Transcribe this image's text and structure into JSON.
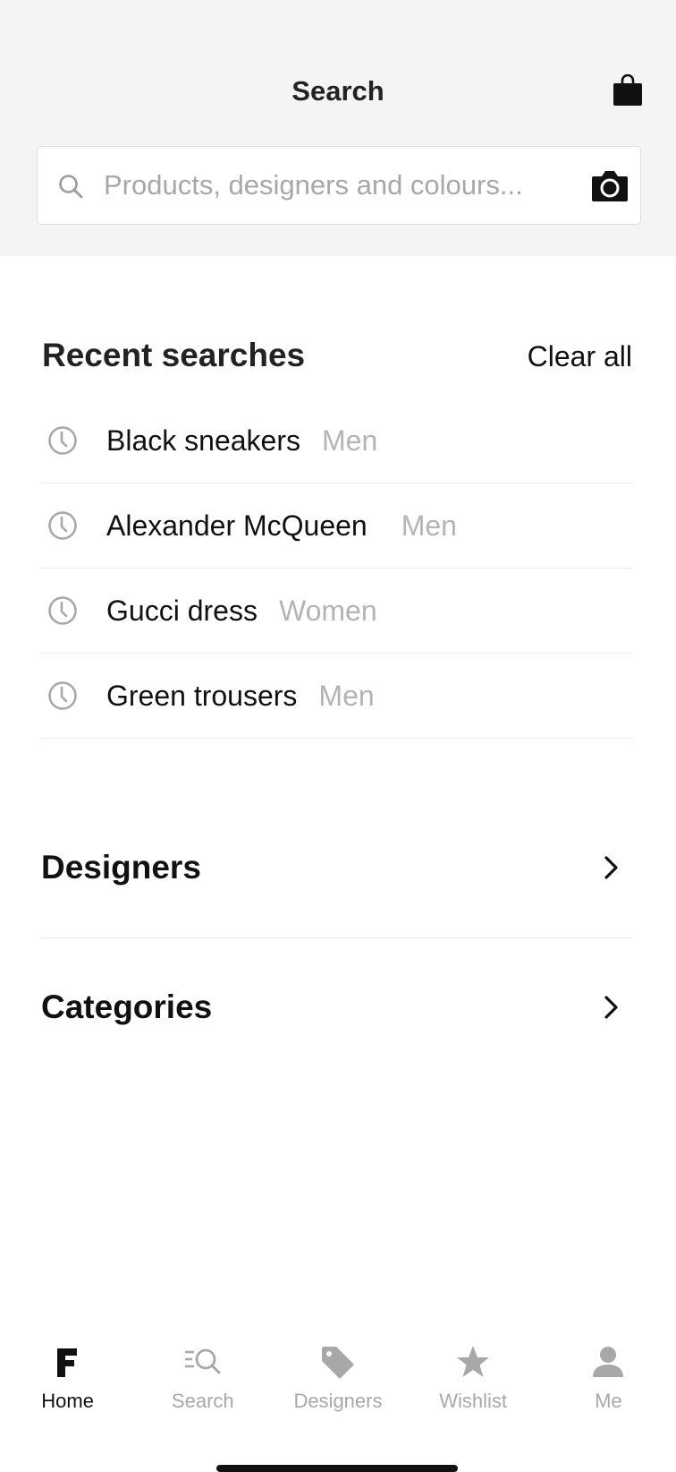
{
  "header": {
    "title": "Search",
    "bag_icon": "shopping-bag-icon"
  },
  "search": {
    "placeholder": "Products, designers and colours...",
    "value": "",
    "search_icon": "search-icon",
    "camera_icon": "camera-icon"
  },
  "recent": {
    "title": "Recent searches",
    "clear_label": "Clear all",
    "items": [
      {
        "query": "Black sneakers",
        "department": "Men"
      },
      {
        "query": "Alexander McQueen",
        "department": "Men"
      },
      {
        "query": "Gucci dress",
        "department": "Women"
      },
      {
        "query": "Green trousers",
        "department": "Men"
      }
    ]
  },
  "sections": {
    "designers": "Designers",
    "categories": "Categories"
  },
  "tabbar": {
    "items": [
      {
        "label": "Home",
        "icon": "home-f-icon",
        "active": true
      },
      {
        "label": "Search",
        "icon": "search-list-icon",
        "active": false
      },
      {
        "label": "Designers",
        "icon": "tag-icon",
        "active": false
      },
      {
        "label": "Wishlist",
        "icon": "star-icon",
        "active": false
      },
      {
        "label": "Me",
        "icon": "person-icon",
        "active": false
      }
    ]
  },
  "colors": {
    "header_bg": "#f4f4f4",
    "text_primary": "#111111",
    "text_muted": "#b4b4b4",
    "divider": "#ececec"
  }
}
